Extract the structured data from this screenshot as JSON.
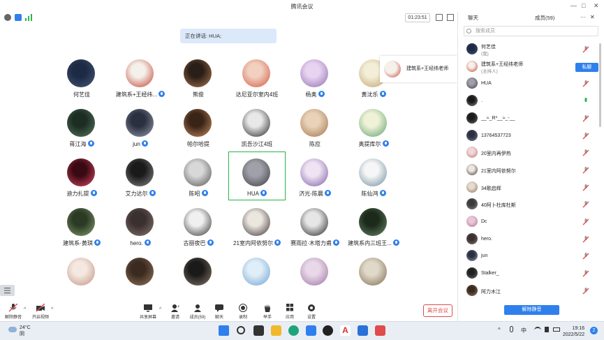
{
  "window": {
    "title": "腾讯会议",
    "min": "—",
    "max": "□",
    "close": "✕"
  },
  "topbar": {
    "timer": "01:23:51"
  },
  "speaking": {
    "label": "正在讲话: HUA;"
  },
  "host_popup": {
    "name": "建筑系+王经纬老师"
  },
  "participants": [
    {
      "name": "何艺佳",
      "mic": false,
      "c": [
        "#1c2a44",
        "#4a5a7a"
      ]
    },
    {
      "name": "建筑系+王经纬...",
      "mic": true,
      "c": [
        "#f4f1ea",
        "#c23b2e"
      ]
    },
    {
      "name": "熊俊",
      "mic": false,
      "c": [
        "#2a1e18",
        "#b07a4f"
      ]
    },
    {
      "name": "达尼亚尔室内4班",
      "mic": false,
      "c": [
        "#f1d0c0",
        "#d4553f"
      ]
    },
    {
      "name": "杨奥",
      "mic": true,
      "c": [
        "#e8d4f0",
        "#8e6bb0"
      ]
    },
    {
      "name": "黄沈乐",
      "mic": true,
      "c": [
        "#f3eed8",
        "#bfa36a"
      ]
    },
    {
      "name": "蒋江海",
      "mic": true,
      "c": [
        "#1c2e24",
        "#5d7a60"
      ]
    },
    {
      "name": "jun",
      "mic": true,
      "c": [
        "#2b3040",
        "#9aa0b0"
      ]
    },
    {
      "name": "帕尔哈提",
      "mic": false,
      "c": [
        "#3a2418",
        "#c89060"
      ]
    },
    {
      "name": "凯吾沙江4班",
      "mic": false,
      "c": [
        "#e8e8e8",
        "#202020"
      ]
    },
    {
      "name": "陈应",
      "mic": false,
      "c": [
        "#e8d2b8",
        "#a07048"
      ]
    },
    {
      "name": "奥提库尔",
      "mic": true,
      "c": [
        "#f0f2d8",
        "#5aa06a"
      ]
    },
    {
      "name": "迪力扎提",
      "mic": true,
      "c": [
        "#3a0a14",
        "#e04a64"
      ]
    },
    {
      "name": "艾力达尔",
      "mic": true,
      "c": [
        "#1a1a1a",
        "#8a8a8a"
      ]
    },
    {
      "name": "陈昭",
      "mic": true,
      "c": [
        "#d8d8d8",
        "#505050"
      ]
    },
    {
      "name": "HUA",
      "mic": true,
      "c": [
        "#a0a0a8",
        "#3a3a40"
      ]
    },
    {
      "name": "济光-陈晨",
      "mic": true,
      "c": [
        "#efe4f4",
        "#7a5aa0"
      ]
    },
    {
      "name": "陈仙鸿",
      "mic": true,
      "c": [
        "#f6f6f6",
        "#6a8a9a"
      ]
    },
    {
      "name": "建筑系-黄琪",
      "mic": true,
      "c": [
        "#2a3a24",
        "#8aa070"
      ]
    },
    {
      "name": "hero.",
      "mic": true,
      "c": [
        "#3a3030",
        "#8a7870"
      ]
    },
    {
      "name": "古丽夜巴",
      "mic": true,
      "c": [
        "#f0f0f0",
        "#303030"
      ]
    },
    {
      "name": "21室内阿依努尔",
      "mic": true,
      "c": [
        "#ece6e0",
        "#3a3030"
      ]
    },
    {
      "name": "赛雨拉·木塔力甫",
      "mic": true,
      "c": [
        "#e6e6e6",
        "#202020"
      ]
    },
    {
      "name": "建筑系内三班王...",
      "mic": true,
      "c": [
        "#1c2a1c",
        "#6a8a6a"
      ]
    },
    {
      "name": "",
      "mic": false,
      "c": [
        "#f4e8e0",
        "#c09080"
      ]
    },
    {
      "name": "",
      "mic": false,
      "c": [
        "#3a2a20",
        "#9a7a60"
      ]
    },
    {
      "name": "",
      "mic": false,
      "c": [
        "#1a1a1a",
        "#8a7a6a"
      ]
    },
    {
      "name": "",
      "mic": false,
      "c": [
        "#e0eef8",
        "#6aa0d0"
      ]
    },
    {
      "name": "",
      "mic": false,
      "c": [
        "#e8d8e8",
        "#9a70a0"
      ]
    },
    {
      "name": "",
      "mic": false,
      "c": [
        "#e0d8c8",
        "#7a6a50"
      ]
    }
  ],
  "toolbar": {
    "mute": "解除静音",
    "video": "开启视频",
    "share": "共享屏幕",
    "invite": "邀请",
    "members": "成员(59)",
    "chat": "聊天",
    "record": "录制",
    "hand": "举手",
    "apps": "应用",
    "settings": "设置",
    "leave": "离开会议"
  },
  "panel": {
    "tab_chat": "聊天",
    "tab_members": "成员(59)",
    "search_placeholder": "搜索成员",
    "unmute_all": "解除静音",
    "private_chat": "私聊",
    "members": [
      {
        "name": "何艺佳",
        "role": "(我)",
        "c": [
          "#1c2a44",
          "#4a5a7a"
        ],
        "mic": "off"
      },
      {
        "name": "建筑系+王经纬老师",
        "role": "(主持人)",
        "c": [
          "#f4f1ea",
          "#c23b2e"
        ],
        "mic": "sel"
      },
      {
        "name": "HUA",
        "role": "",
        "c": [
          "#a0a0a8",
          "#3a3a40"
        ],
        "mic": "off"
      },
      {
        "name": ".",
        "role": "",
        "c": [
          "#1a1a1a",
          "#8a8a8a"
        ],
        "mic": "on"
      },
      {
        "name": "__≈_R³__≈_-__",
        "role": "",
        "c": [
          "#1a1a1a",
          "#6a6a6a"
        ],
        "mic": "off"
      },
      {
        "name": "13764537723",
        "role": "",
        "c": [
          "#2a3040",
          "#7a8090"
        ],
        "mic": "off"
      },
      {
        "name": "20室内再伊热",
        "role": "",
        "c": [
          "#f0d8d8",
          "#c07070"
        ],
        "mic": "off"
      },
      {
        "name": "21室内阿依努尔",
        "role": "",
        "c": [
          "#ece6e0",
          "#3a3030"
        ],
        "mic": "off"
      },
      {
        "name": "34歌启辉",
        "role": "",
        "c": [
          "#e4dcd0",
          "#8a7050"
        ],
        "mic": "off"
      },
      {
        "name": "40阿卜杜库杜斯",
        "role": "",
        "c": [
          "#3a3a3a",
          "#8a8a8a"
        ],
        "mic": "off"
      },
      {
        "name": "Dc",
        "role": "",
        "c": [
          "#e8c8d8",
          "#b06a8a"
        ],
        "mic": "off"
      },
      {
        "name": "hero.",
        "role": "",
        "c": [
          "#3a3030",
          "#8a7870"
        ],
        "mic": "off"
      },
      {
        "name": "jun",
        "role": "",
        "c": [
          "#2b3040",
          "#9aa0b0"
        ],
        "mic": "off"
      },
      {
        "name": "Stalker_",
        "role": "",
        "c": [
          "#202020",
          "#707070"
        ],
        "mic": "off"
      },
      {
        "name": "阿力木江",
        "role": "",
        "c": [
          "#3a2a20",
          "#9a7a60"
        ],
        "mic": "off"
      }
    ]
  },
  "taskbar": {
    "temp": "24°C",
    "weather": "阴",
    "time": "19:16",
    "date": "2022/5/22",
    "ime": "中",
    "notif": "2"
  }
}
